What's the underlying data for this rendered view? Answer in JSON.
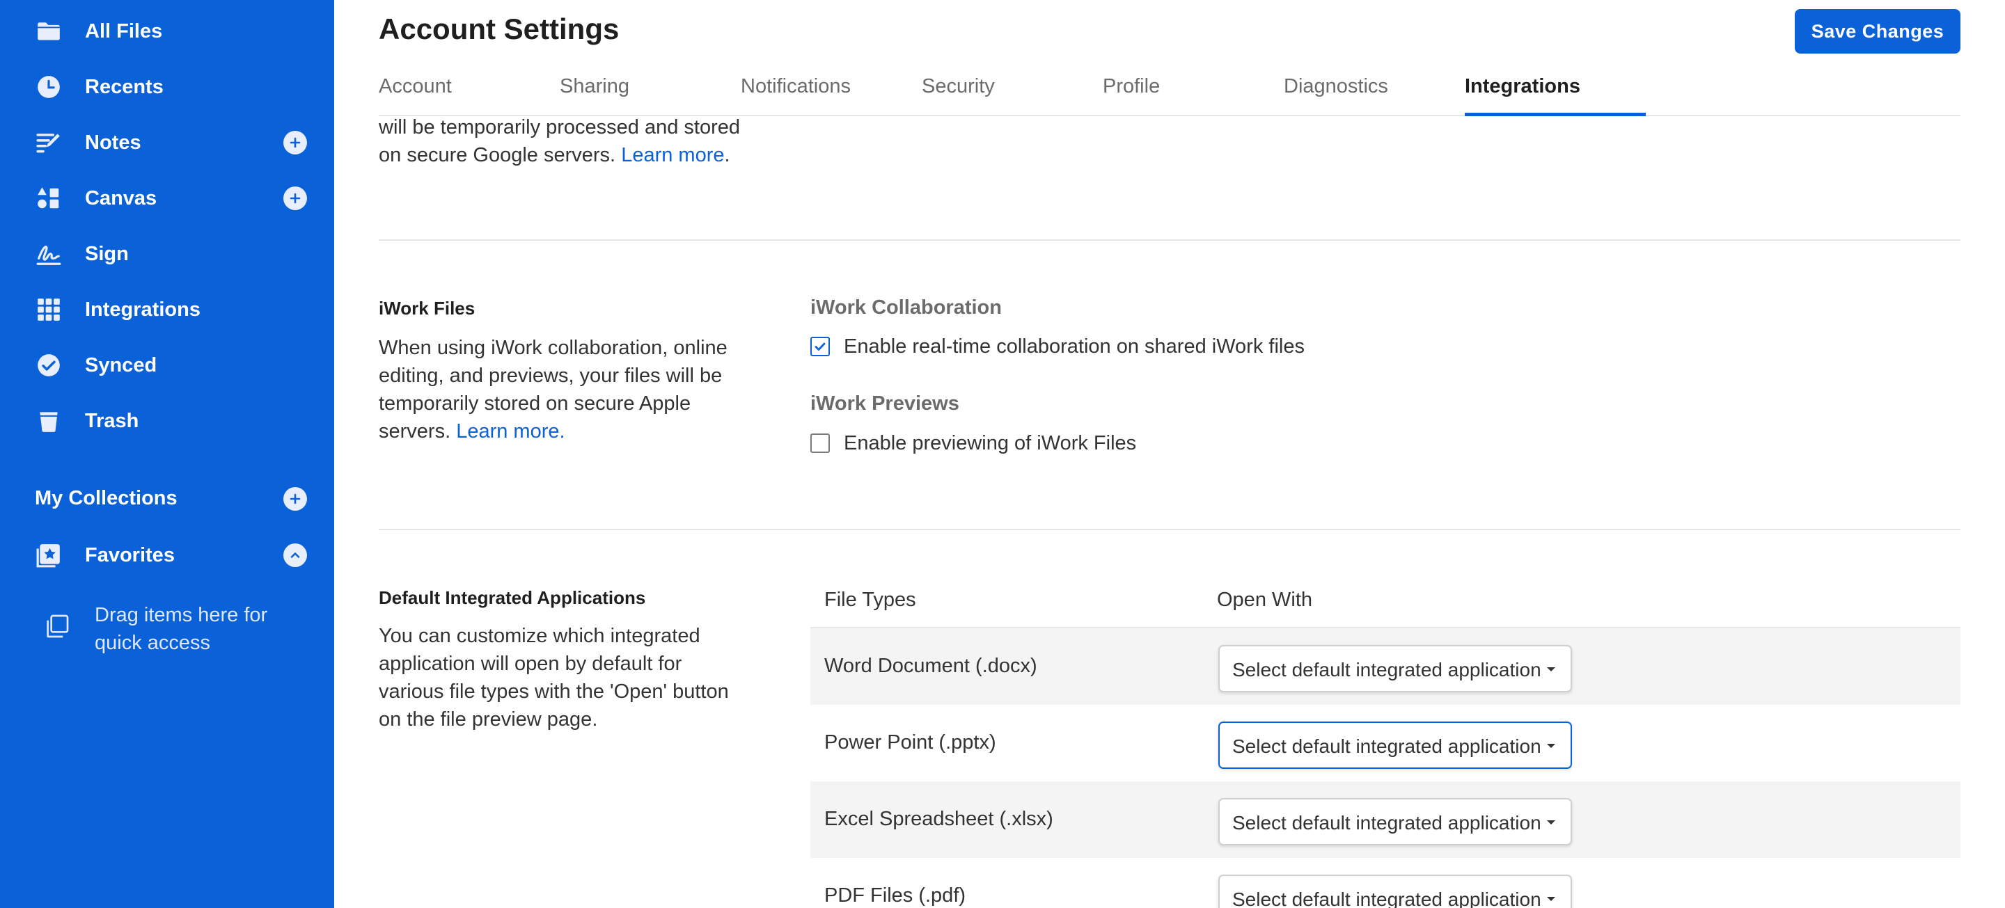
{
  "colors": {
    "sidebar_bg": "#0b61d8",
    "accent": "#0b61d8",
    "row_shade": "#f4f4f4"
  },
  "sidebar": {
    "items": [
      {
        "label": "All Files",
        "icon": "folder-icon"
      },
      {
        "label": "Recents",
        "icon": "clock-icon"
      },
      {
        "label": "Notes",
        "icon": "notes-icon",
        "has_add": true
      },
      {
        "label": "Canvas",
        "icon": "canvas-icon",
        "has_add": true
      },
      {
        "label": "Sign",
        "icon": "signature-icon"
      },
      {
        "label": "Integrations",
        "icon": "grid-icon"
      },
      {
        "label": "Synced",
        "icon": "check-circle-icon"
      },
      {
        "label": "Trash",
        "icon": "trash-icon"
      }
    ],
    "collections_label": "My Collections",
    "favorites_label": "Favorites",
    "drag_hint": "Drag items here for quick access"
  },
  "header": {
    "title": "Account Settings",
    "save_label": "Save Changes",
    "tabs": [
      "Account",
      "Sharing",
      "Notifications",
      "Security",
      "Profile",
      "Diagnostics",
      "Integrations"
    ],
    "active_tab": "Integrations"
  },
  "top_section": {
    "text": "will be temporarily processed and stored on secure Google servers.",
    "link": "Learn more",
    "trailing": "."
  },
  "iwork": {
    "title": "iWork Files",
    "description": "When using iWork collaboration, online editing, and previews, your files will be temporarily stored on secure Apple servers.",
    "link": "Learn more.",
    "collab_heading": "iWork Collaboration",
    "collab_label": "Enable real-time collaboration on shared iWork files",
    "collab_checked": true,
    "previews_heading": "iWork Previews",
    "previews_label": "Enable previewing of iWork Files",
    "previews_checked": false
  },
  "default_apps": {
    "title": "Default Integrated Applications",
    "description": "You can customize which integrated application will open by default for various file types with the 'Open' button on the file preview page.",
    "col_file_types": "File Types",
    "col_open_with": "Open With",
    "rows": [
      {
        "file_type": "Word Document (.docx)",
        "select": "Select default integrated application"
      },
      {
        "file_type": "Power Point (.pptx)",
        "select": "Select default integrated application"
      },
      {
        "file_type": "Excel Spreadsheet (.xlsx)",
        "select": "Select default integrated application"
      },
      {
        "file_type": "PDF Files (.pdf)",
        "select": "Select default integrated application"
      }
    ]
  }
}
